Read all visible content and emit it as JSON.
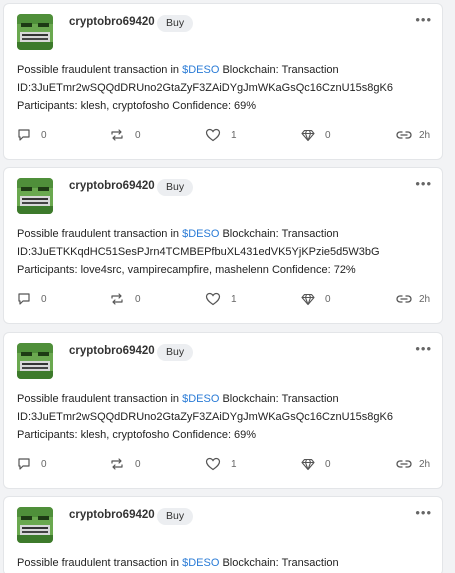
{
  "posts": [
    {
      "username": "cryptobro69420",
      "buy_label": "Buy",
      "text_prefix": "Possible fraudulent transaction in ",
      "text_tag": "$DESO",
      "text_suffix": " Blockchain: Transaction",
      "tx_line": "ID:3JuETmr2wSQQdDRUno2GtaZyF3ZAiDYgJmWKaGsQc16CznU15s8gK6",
      "participants_line": "Participants: klesh, cryptofosho Confidence: 69%",
      "comments": "0",
      "reposts": "0",
      "likes": "1",
      "diamonds": "0",
      "time": "2h"
    },
    {
      "username": "cryptobro69420",
      "buy_label": "Buy",
      "text_prefix": "Possible fraudulent transaction in ",
      "text_tag": "$DESO",
      "text_suffix": " Blockchain: Transaction",
      "tx_line": "ID:3JuETKKqdHC51SesPJrn4TCMBEPfbuXL431edVK5YjKPzie5d5W3bG",
      "participants_line": "Participants: love4src, vampirecampfire, mashelenn Confidence: 72%",
      "comments": "0",
      "reposts": "0",
      "likes": "1",
      "diamonds": "0",
      "time": "2h"
    },
    {
      "username": "cryptobro69420",
      "buy_label": "Buy",
      "text_prefix": "Possible fraudulent transaction in ",
      "text_tag": "$DESO",
      "text_suffix": " Blockchain: Transaction",
      "tx_line": "ID:3JuETmr2wSQQdDRUno2GtaZyF3ZAiDYgJmWKaGsQc16CznU15s8gK6",
      "participants_line": "Participants: klesh, cryptofosho Confidence: 69%",
      "comments": "0",
      "reposts": "0",
      "likes": "1",
      "diamonds": "0",
      "time": "2h"
    },
    {
      "username": "cryptobro69420",
      "buy_label": "Buy",
      "text_prefix": "Possible fraudulent transaction in ",
      "text_tag": "$DESO",
      "text_suffix": " Blockchain: Transaction"
    }
  ],
  "icons": {
    "more": "more-dots-icon",
    "comment": "comment-icon",
    "repost": "repost-icon",
    "like": "heart-icon",
    "diamond": "diamond-icon",
    "link": "link-icon"
  },
  "colors": {
    "link_tag": "#2a7bd6",
    "avatar_green": "#5fa843"
  }
}
